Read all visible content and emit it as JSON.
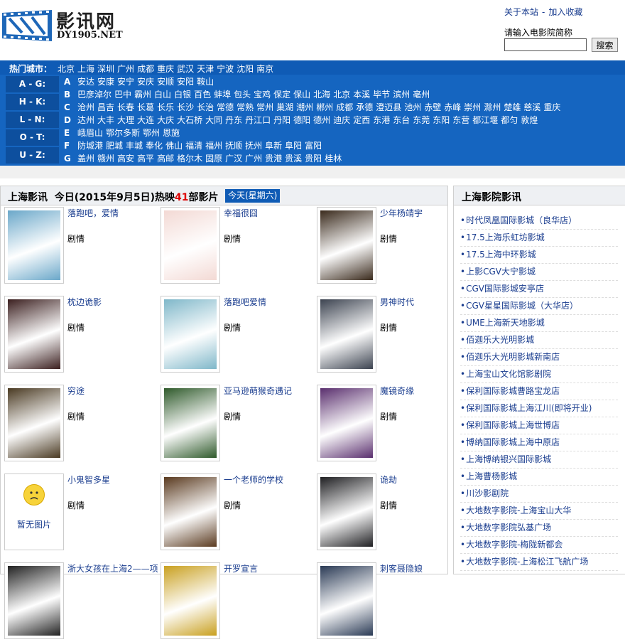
{
  "logo": {
    "cn": "影讯网",
    "en": "DY1905.NET"
  },
  "toplinks": {
    "about": "关于本站",
    "sep": "-",
    "favorite": "加入收藏"
  },
  "search": {
    "label": "请输入电影院简称",
    "value": "",
    "button": "搜索"
  },
  "citybar": {
    "label": "热门城市：",
    "cities": [
      "北京",
      "上海",
      "深圳",
      "广州",
      "成都",
      "重庆",
      "武汉",
      "天津",
      "宁波",
      "沈阳",
      "南京"
    ]
  },
  "letter_groups": [
    "A - G:",
    "H - K:",
    "L - N:",
    "O - T:",
    "U - Z:"
  ],
  "city_rows": [
    {
      "key": "A",
      "cities": [
        "安达",
        "安康",
        "安宁",
        "安庆",
        "安顺",
        "安阳",
        "鞍山"
      ]
    },
    {
      "key": "B",
      "cities": [
        "巴彦淖尔",
        "巴中",
        "霸州",
        "白山",
        "白银",
        "百色",
        "蚌埠",
        "包头",
        "宝鸡",
        "保定",
        "保山",
        "北海",
        "北京",
        "本溪",
        "毕节",
        "滨州",
        "亳州"
      ]
    },
    {
      "key": "C",
      "cities": [
        "沧州",
        "昌吉",
        "长春",
        "长葛",
        "长乐",
        "长沙",
        "长治",
        "常德",
        "常熟",
        "常州",
        "巢湖",
        "潮州",
        "郴州",
        "成都",
        "承德",
        "澄迈县",
        "池州",
        "赤壁",
        "赤峰",
        "崇州",
        "滁州",
        "楚雄",
        "慈溪",
        "重庆"
      ]
    },
    {
      "key": "D",
      "cities": [
        "达州",
        "大丰",
        "大理",
        "大连",
        "大庆",
        "大石桥",
        "大同",
        "丹东",
        "丹江口",
        "丹阳",
        "德阳",
        "德州",
        "迪庆",
        "定西",
        "东港",
        "东台",
        "东莞",
        "东阳",
        "东营",
        "都江堰",
        "都匀",
        "敦煌"
      ]
    },
    {
      "key": "E",
      "cities": [
        "峨眉山",
        "鄂尔多斯",
        "鄂州",
        "恩施"
      ]
    },
    {
      "key": "F",
      "cities": [
        "防城港",
        "肥城",
        "丰城",
        "奉化",
        "佛山",
        "福清",
        "福州",
        "抚顺",
        "抚州",
        "阜新",
        "阜阳",
        "富阳"
      ]
    },
    {
      "key": "G",
      "cities": [
        "盖州",
        "赣州",
        "高安",
        "高平",
        "高邮",
        "格尔木",
        "固原",
        "广汉",
        "广州",
        "贵港",
        "贵溪",
        "贵阳",
        "桂林"
      ]
    }
  ],
  "main": {
    "title_city": "上海影讯",
    "title_date": "今日(2015年9月5日)热映",
    "title_count": "41",
    "title_suffix": "部影片",
    "today_tab": "今天(星期六)",
    "genre_label": "剧情",
    "no_image_text": "暂无图片",
    "movies": [
      {
        "title": "落跑吧，爱情",
        "genre": "剧情"
      },
      {
        "title": "幸福很囧",
        "genre": "剧情"
      },
      {
        "title": "少年杨靖宇",
        "genre": "剧情"
      },
      {
        "title": "枕边诡影",
        "genre": "剧情"
      },
      {
        "title": "落跑吧爱情",
        "genre": "剧情"
      },
      {
        "title": "男神时代",
        "genre": "剧情"
      },
      {
        "title": "穷途",
        "genre": "剧情"
      },
      {
        "title": "亚马逊萌猴奇遇记",
        "genre": "剧情"
      },
      {
        "title": "魔镜奇缘",
        "genre": "剧情"
      },
      {
        "title": "小鬼智多星",
        "genre": "剧情"
      },
      {
        "title": "一个老师的学校",
        "genre": "剧情"
      },
      {
        "title": "诡劫",
        "genre": "剧情"
      },
      {
        "title": "浙大女孩在上海2——项",
        "genre": ""
      },
      {
        "title": "开罗宣言",
        "genre": ""
      },
      {
        "title": "刺客聂隐娘",
        "genre": ""
      }
    ],
    "poster_colors": [
      "#6aa7c9",
      "#f3d9d4",
      "#3a2a1c",
      "#3b1f1f",
      "#7fb7c9",
      "#3c4350",
      "#4a3a22",
      "#2f5a2b",
      "#5a2f6e",
      "#ffffff",
      "#5a3a1f",
      "#1f1f22",
      "#222",
      "#c9a020",
      "#2a3a55"
    ]
  },
  "side": {
    "title": "上海影院影讯",
    "cinemas": [
      "时代凤凰国际影城（良华店）",
      "17.5上海乐虹坊影城",
      "17.5上海中环影城",
      "上影CGV大宁影城",
      "CGV国际影城安亭店",
      "CGV星星国际影城（大华店）",
      "UME上海新天地影城",
      "佰迦乐大光明影城",
      "佰迦乐大光明影城新南店",
      "上海宝山文化馆影剧院",
      "保利国际影城曹路宝龙店",
      "保利国际影城上海江川(即将开业)",
      "保利国际影城上海世博店",
      "博纳国际影城上海中原店",
      "上海博纳银兴国际影城",
      "上海曹杨影城",
      "川沙影剧院",
      "大地数字影院-上海宝山大华",
      "大地数字影院弘基广场",
      "大地数字影院-梅陇新都会",
      "大地数字影院-上海松江飞航广场"
    ]
  }
}
